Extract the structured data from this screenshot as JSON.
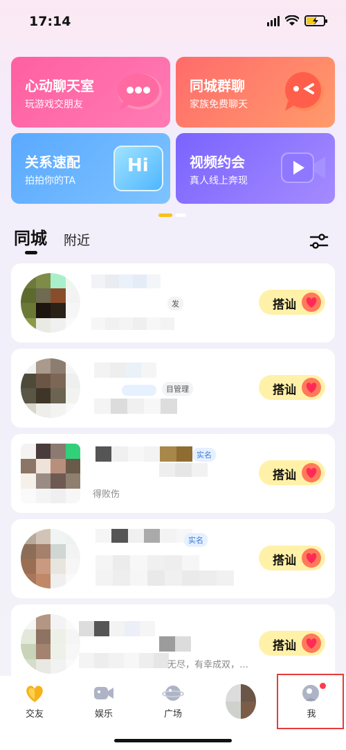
{
  "status_bar": {
    "time": "17:14"
  },
  "features": [
    {
      "title": "心动聊天室",
      "subtitle": "玩游戏交朋友"
    },
    {
      "title": "同城群聊",
      "subtitle": "家族免费聊天"
    },
    {
      "title": "关系速配",
      "subtitle": "拍拍你的TA",
      "badge": "Hi"
    },
    {
      "title": "视频约会",
      "subtitle": "真人线上奔现"
    }
  ],
  "tabs": {
    "city": "同城",
    "nearby": "附近"
  },
  "users": [
    {
      "tag": "发",
      "snippet": "",
      "accost": "搭讪"
    },
    {
      "tag": "目管理",
      "snippet": "",
      "accost": "搭讪"
    },
    {
      "tag": "实名",
      "snippet": "得败伤",
      "accost": "搭讪"
    },
    {
      "tag": "实名",
      "snippet": "",
      "accost": "搭讪"
    },
    {
      "tag": "",
      "snippet": "无尽，有幸成双，…",
      "accost": "搭讪"
    }
  ],
  "tabbar": [
    {
      "label": "交友",
      "icon": "heart-icon"
    },
    {
      "label": "娱乐",
      "icon": "video-camera-icon"
    },
    {
      "label": "广场",
      "icon": "planet-icon"
    },
    {
      "label": "",
      "icon": "avatar"
    },
    {
      "label": "我",
      "icon": "profile-icon"
    }
  ],
  "colors": {
    "accent_yellow": "#f7c21a",
    "notify_red": "#ff3b4e",
    "highlight_red": "#e43b3b"
  }
}
